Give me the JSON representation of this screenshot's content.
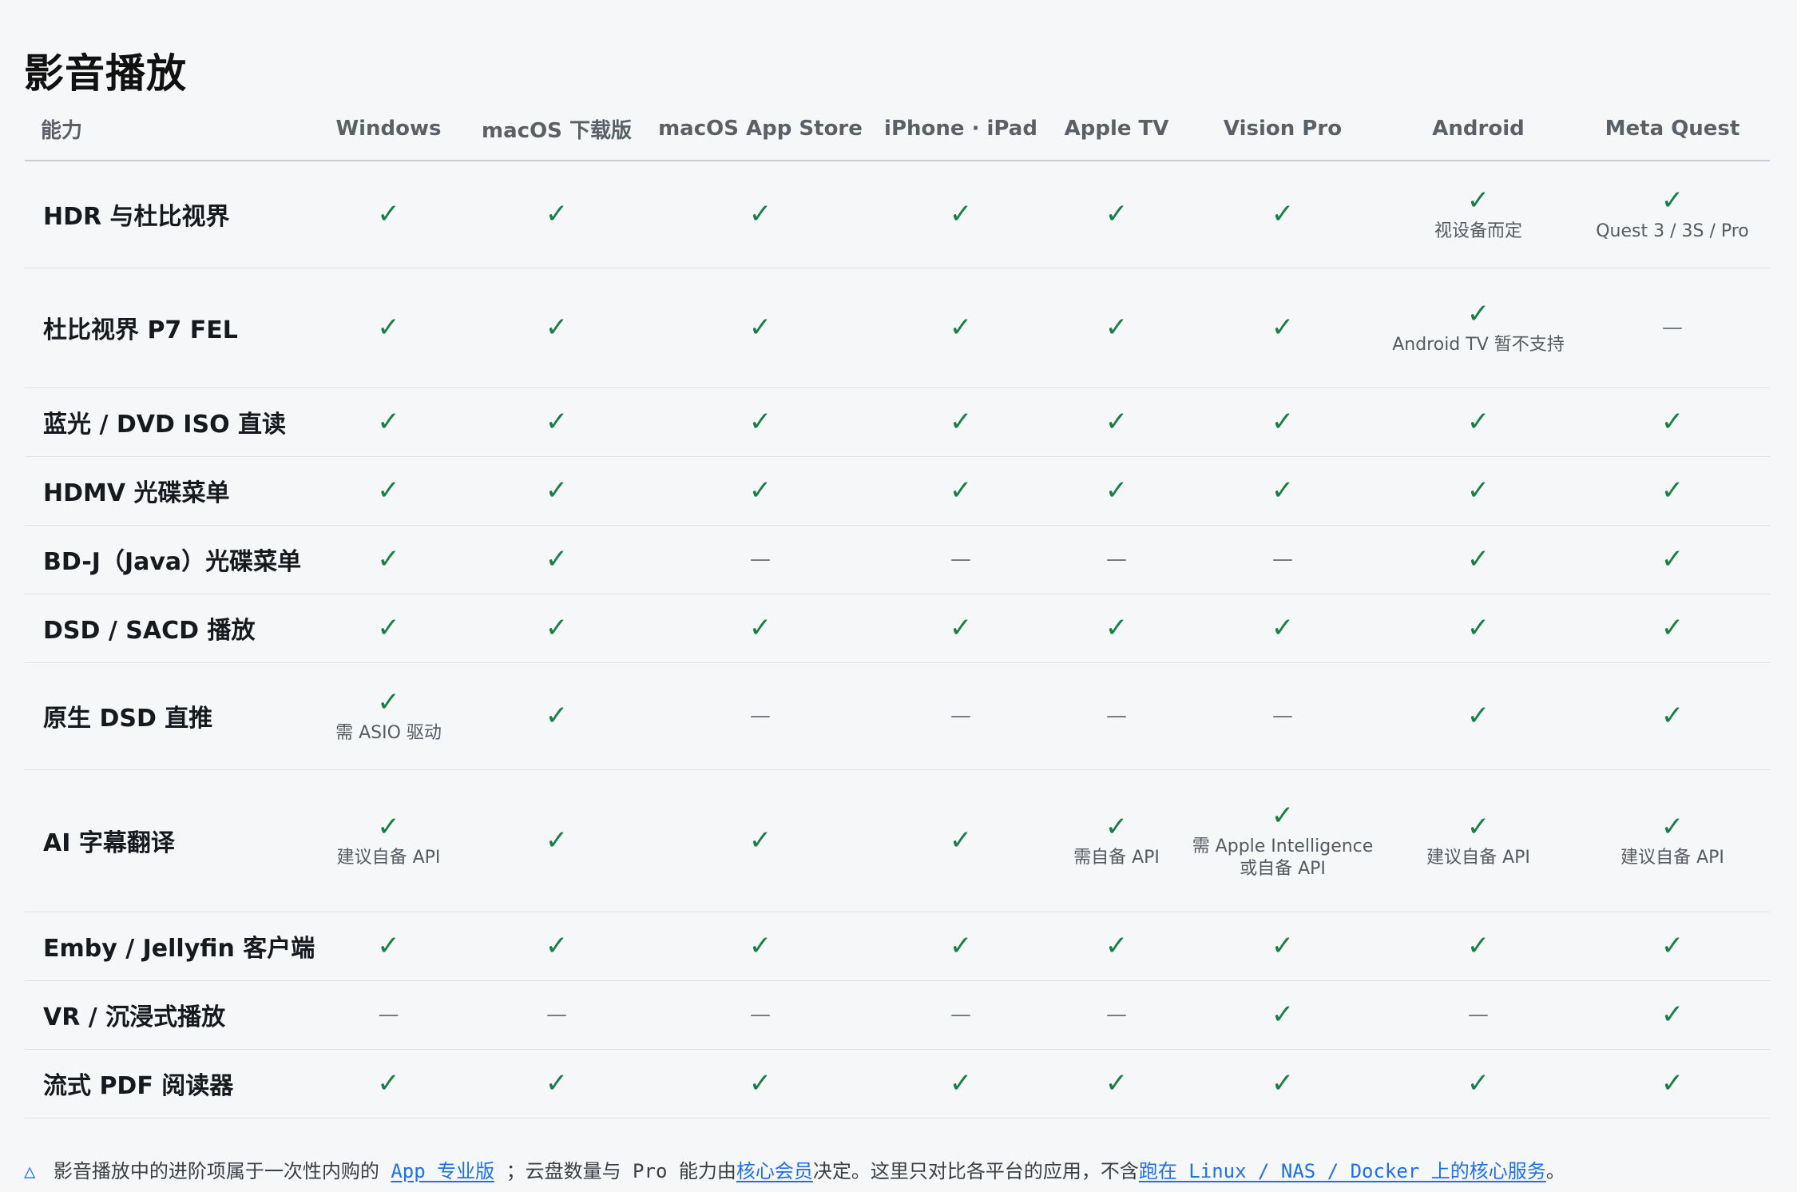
{
  "page": {
    "title": "影音播放"
  },
  "table": {
    "corner_label": "能力",
    "platforms": [
      "Windows",
      "macOS 下载版",
      "macOS App Store",
      "iPhone · iPad",
      "Apple TV",
      "Vision Pro",
      "Android",
      "Meta Quest"
    ],
    "status_symbols": {
      "yes": "✓",
      "no": "—"
    },
    "colors": {
      "yes": "#1a7f46",
      "no": "#6f757c",
      "link": "#1f6feb"
    },
    "rows": [
      {
        "capability": "HDR 与杜比视界",
        "cells": [
          {
            "s": "yes"
          },
          {
            "s": "yes"
          },
          {
            "s": "yes"
          },
          {
            "s": "yes"
          },
          {
            "s": "yes"
          },
          {
            "s": "yes"
          },
          {
            "s": "yes",
            "note": "视设备而定"
          },
          {
            "s": "yes",
            "note": "Quest 3 / 3S / Pro"
          }
        ]
      },
      {
        "capability": "杜比视界 P7 FEL",
        "cells": [
          {
            "s": "yes"
          },
          {
            "s": "yes"
          },
          {
            "s": "yes"
          },
          {
            "s": "yes"
          },
          {
            "s": "yes"
          },
          {
            "s": "yes"
          },
          {
            "s": "yes",
            "note": "Android TV 暂不支持"
          },
          {
            "s": "no"
          }
        ]
      },
      {
        "capability": "蓝光 / DVD ISO 直读",
        "cells": [
          {
            "s": "yes"
          },
          {
            "s": "yes"
          },
          {
            "s": "yes"
          },
          {
            "s": "yes"
          },
          {
            "s": "yes"
          },
          {
            "s": "yes"
          },
          {
            "s": "yes"
          },
          {
            "s": "yes"
          }
        ]
      },
      {
        "capability": "HDMV 光碟菜单",
        "cells": [
          {
            "s": "yes"
          },
          {
            "s": "yes"
          },
          {
            "s": "yes"
          },
          {
            "s": "yes"
          },
          {
            "s": "yes"
          },
          {
            "s": "yes"
          },
          {
            "s": "yes"
          },
          {
            "s": "yes"
          }
        ]
      },
      {
        "capability": "BD-J（Java）光碟菜单",
        "cells": [
          {
            "s": "yes"
          },
          {
            "s": "yes"
          },
          {
            "s": "no"
          },
          {
            "s": "no"
          },
          {
            "s": "no"
          },
          {
            "s": "no"
          },
          {
            "s": "yes"
          },
          {
            "s": "yes"
          }
        ]
      },
      {
        "capability": "DSD / SACD 播放",
        "cells": [
          {
            "s": "yes"
          },
          {
            "s": "yes"
          },
          {
            "s": "yes"
          },
          {
            "s": "yes"
          },
          {
            "s": "yes"
          },
          {
            "s": "yes"
          },
          {
            "s": "yes"
          },
          {
            "s": "yes"
          }
        ]
      },
      {
        "capability": "原生 DSD 直推",
        "cells": [
          {
            "s": "yes",
            "note": "需 ASIO 驱动"
          },
          {
            "s": "yes"
          },
          {
            "s": "no"
          },
          {
            "s": "no"
          },
          {
            "s": "no"
          },
          {
            "s": "no"
          },
          {
            "s": "yes"
          },
          {
            "s": "yes"
          }
        ]
      },
      {
        "capability": "AI 字幕翻译",
        "cells": [
          {
            "s": "yes",
            "note": "建议自备 API"
          },
          {
            "s": "yes"
          },
          {
            "s": "yes"
          },
          {
            "s": "yes"
          },
          {
            "s": "yes",
            "note": "需自备 API"
          },
          {
            "s": "yes",
            "note": "需 Apple Intelligence 或自备 API"
          },
          {
            "s": "yes",
            "note": "建议自备 API"
          },
          {
            "s": "yes",
            "note": "建议自备 API"
          }
        ]
      },
      {
        "capability": "Emby / Jellyfin 客户端",
        "cells": [
          {
            "s": "yes"
          },
          {
            "s": "yes"
          },
          {
            "s": "yes"
          },
          {
            "s": "yes"
          },
          {
            "s": "yes"
          },
          {
            "s": "yes"
          },
          {
            "s": "yes"
          },
          {
            "s": "yes"
          }
        ]
      },
      {
        "capability": "VR / 沉浸式播放",
        "cells": [
          {
            "s": "no"
          },
          {
            "s": "no"
          },
          {
            "s": "no"
          },
          {
            "s": "no"
          },
          {
            "s": "no"
          },
          {
            "s": "yes"
          },
          {
            "s": "no"
          },
          {
            "s": "yes"
          }
        ]
      },
      {
        "capability": "流式 PDF 阅读器",
        "cells": [
          {
            "s": "yes"
          },
          {
            "s": "yes"
          },
          {
            "s": "yes"
          },
          {
            "s": "yes"
          },
          {
            "s": "yes"
          },
          {
            "s": "yes"
          },
          {
            "s": "yes"
          },
          {
            "s": "yes"
          }
        ]
      }
    ]
  },
  "footer": {
    "icon": "△",
    "icon_name": "warning-icon",
    "text_1": "影音播放中的进阶项属于一次性内购的",
    "link_1": "App 专业版",
    "text_2": "；云盘数量与 Pro 能力由",
    "link_2": "核心会员",
    "text_3": "决定。这里只对比各平台的应用，不含",
    "link_3": "跑在 Linux / NAS / Docker 上的核心服务",
    "text_4": "。"
  }
}
